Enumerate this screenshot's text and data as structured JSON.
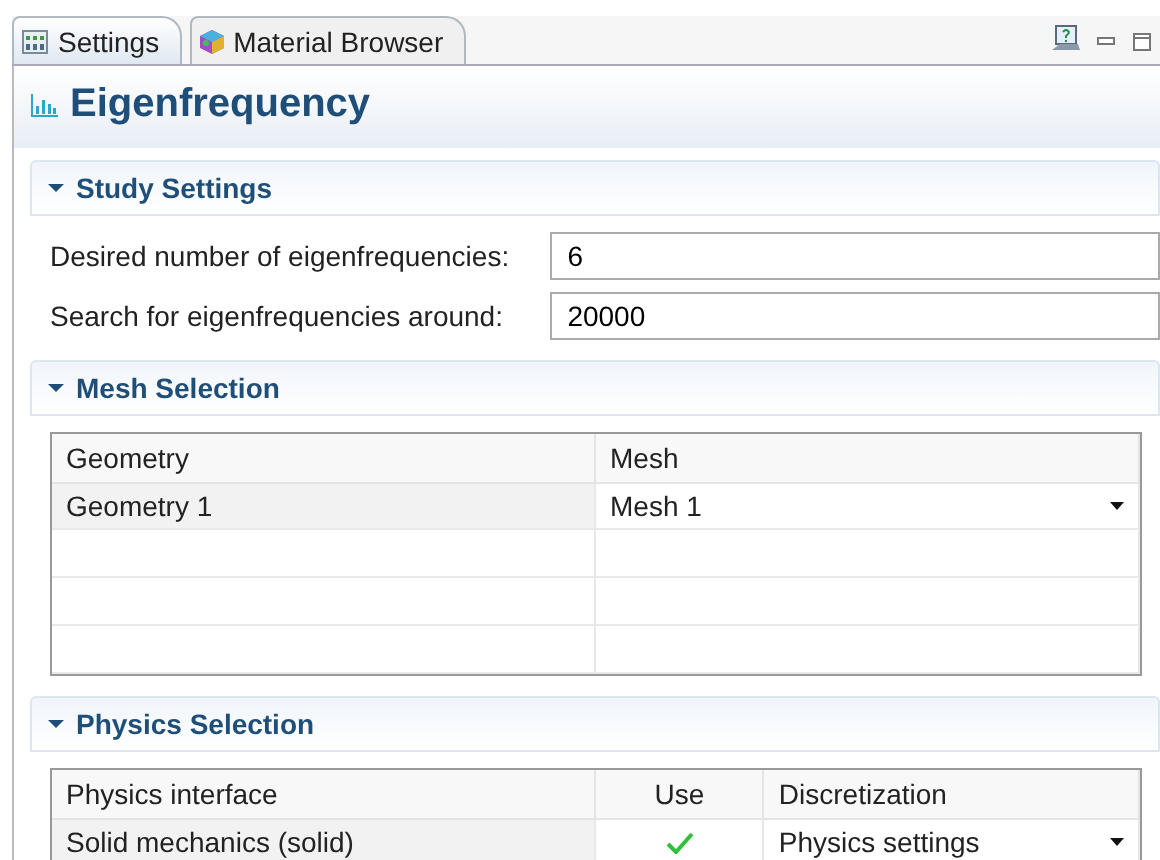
{
  "tabs": [
    {
      "label": "Settings",
      "selected": true,
      "kind": "settings"
    },
    {
      "label": "Material Browser",
      "selected": false,
      "kind": "material"
    }
  ],
  "page_title": "Eigenfrequency",
  "sections": [
    {
      "kind": "fields",
      "title": "Study Settings",
      "expanded": true,
      "fields": [
        {
          "label": "Desired number of eigenfrequencies:",
          "value": "6"
        },
        {
          "label": "Search for eigenfrequencies around:",
          "value": "20000"
        }
      ]
    },
    {
      "kind": "table",
      "title": "Mesh Selection",
      "expanded": true,
      "columns": [
        "Geometry",
        "Mesh"
      ],
      "rows": [
        {
          "cells": [
            "Geometry 1",
            "Mesh 1"
          ],
          "use": null
        }
      ]
    },
    {
      "kind": "table",
      "title": "Physics Selection",
      "expanded": true,
      "columns": [
        "Physics interface",
        "Use",
        "Discretization"
      ],
      "rows": [
        {
          "cells": [
            "Solid mechanics (solid)",
            null,
            "Physics settings"
          ],
          "use": true
        }
      ]
    }
  ]
}
